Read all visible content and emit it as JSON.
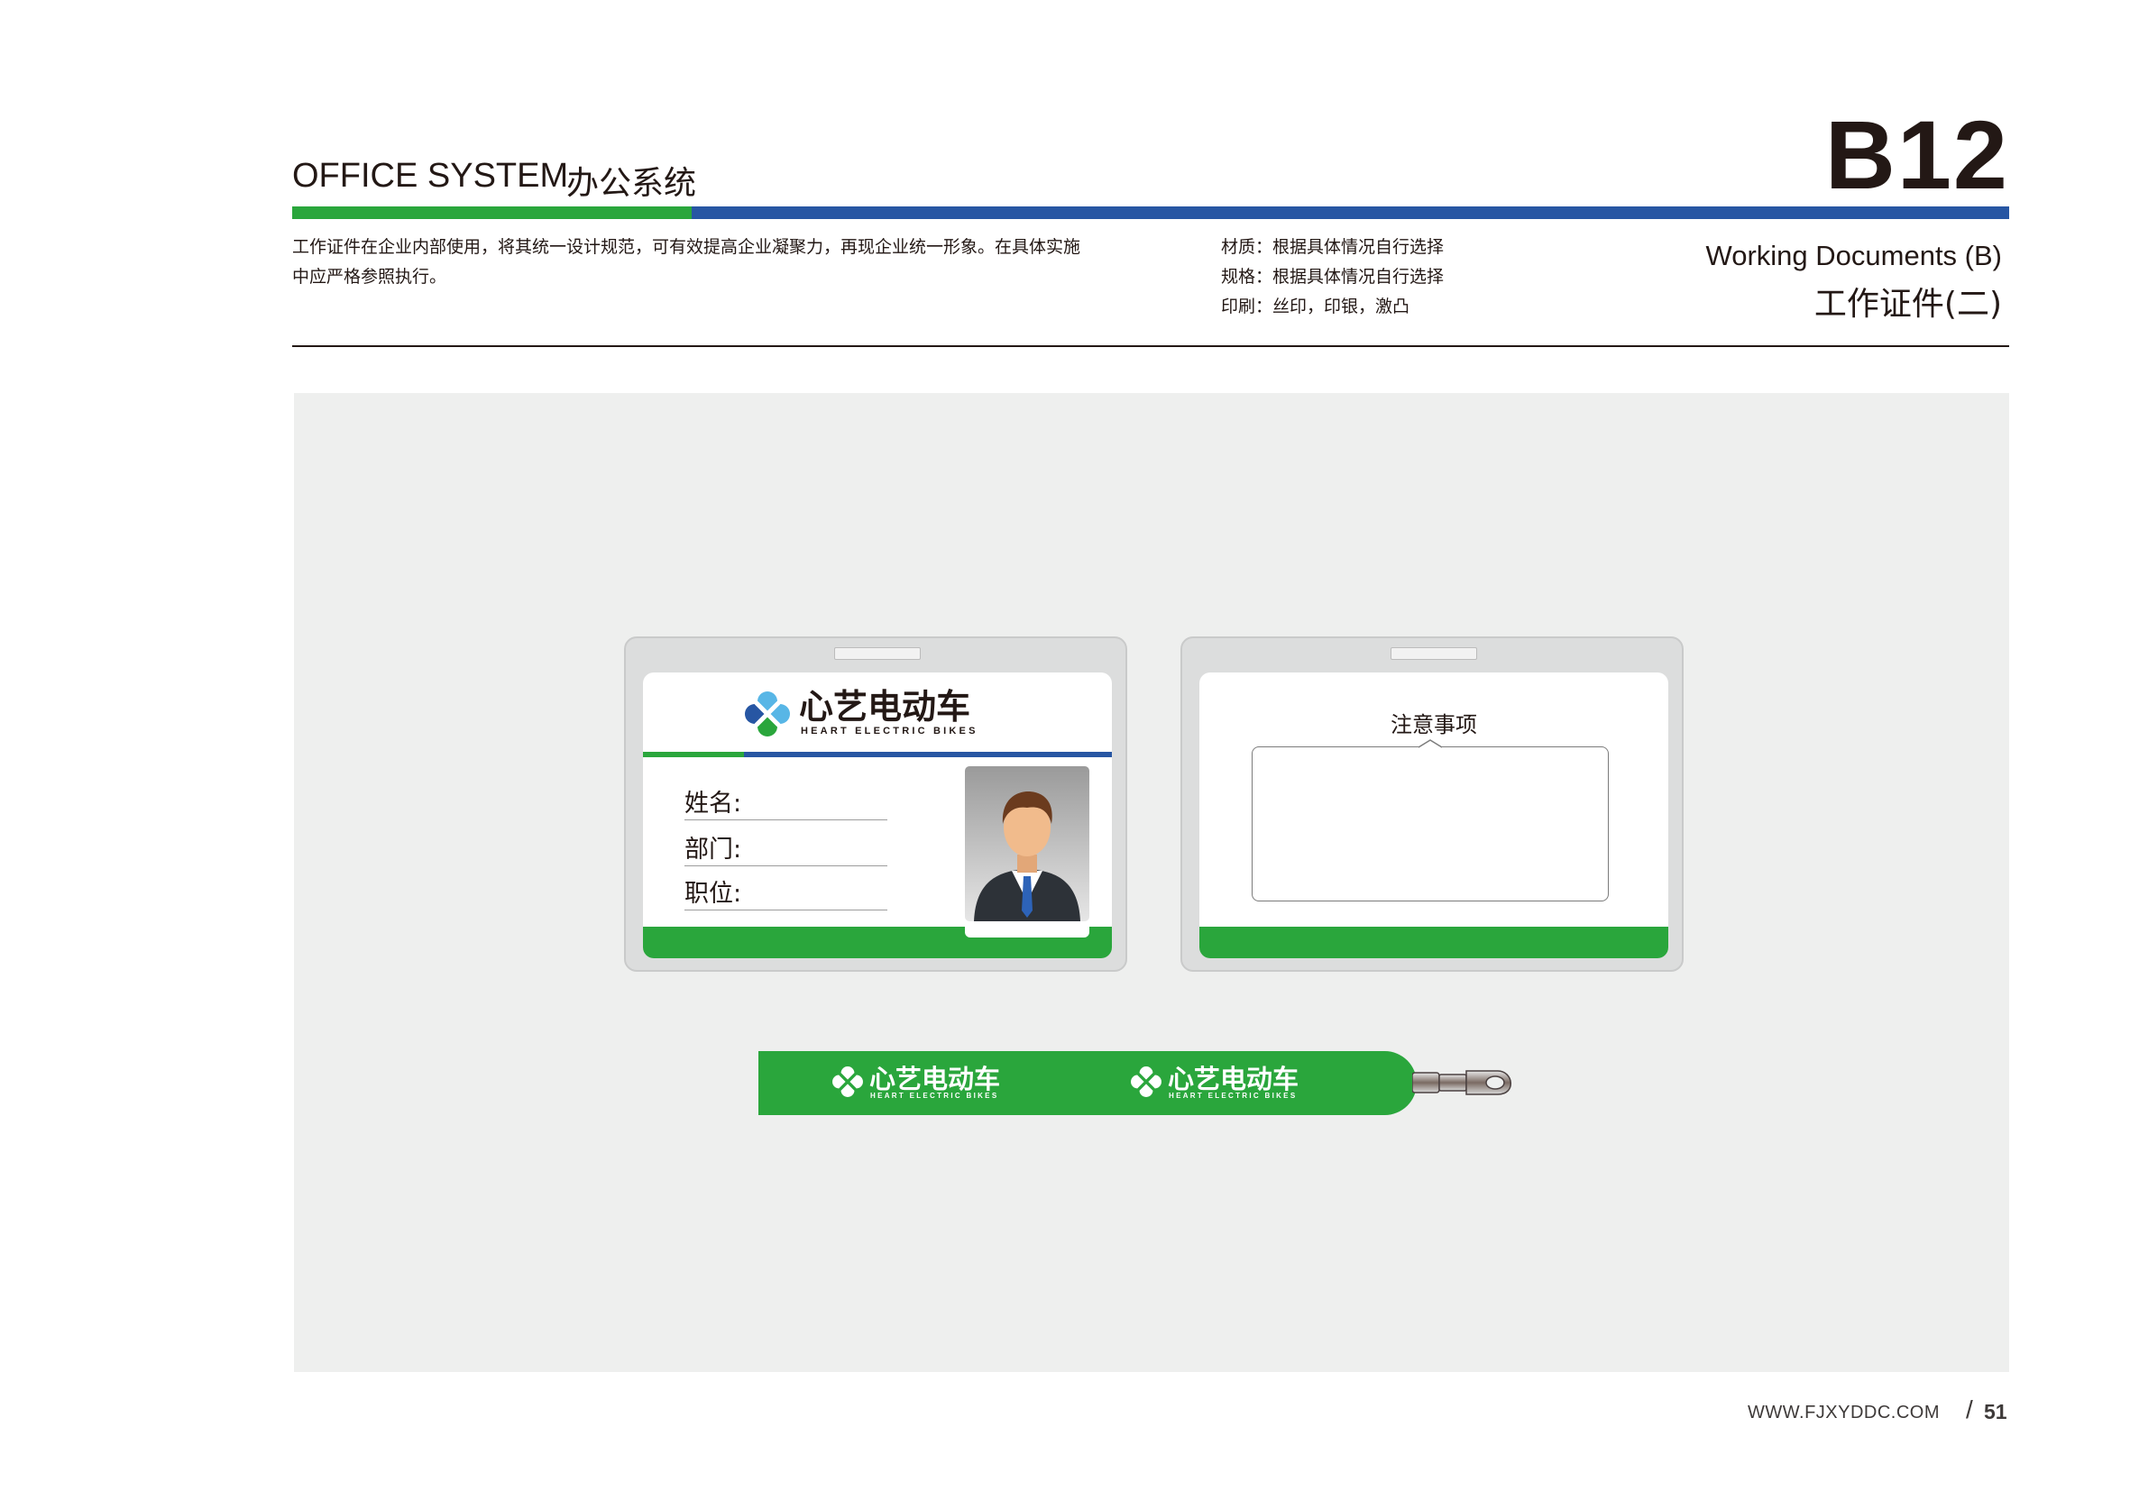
{
  "header": {
    "section_en": "OFFICE SYSTEM",
    "section_cn": "办公系统",
    "code": "B12",
    "description": "工作证件在企业内部使用，将其统一设计规范，可有效提高企业凝聚力，再现企业统一形象。在具体实施中应严格参照执行。",
    "specs": [
      "材质：根据具体情况自行选择",
      "规格：根据具体情况自行选择",
      "印刷：丝印，印银，激凸"
    ],
    "title_en": "Working Documents (B)",
    "title_cn": "工作证件(二)"
  },
  "brand": {
    "name_cn": "心艺电动车",
    "name_en": "HEART ELECTRIC BIKES"
  },
  "front_card": {
    "fields": [
      "姓名:",
      "部门:",
      "职位:"
    ]
  },
  "back_card": {
    "title": "注意事项"
  },
  "footer": {
    "website": "WWW.FJXYDDC.COM",
    "slash": "/",
    "page": "51"
  },
  "colors": {
    "brand_green": "#2aa63c",
    "brand_blue": "#2756a3",
    "panel_bg": "#eeefee",
    "text": "#231815"
  },
  "icons": [
    "clover-logo-icon",
    "avatar-businessman-icon",
    "lanyard-clip-icon"
  ]
}
